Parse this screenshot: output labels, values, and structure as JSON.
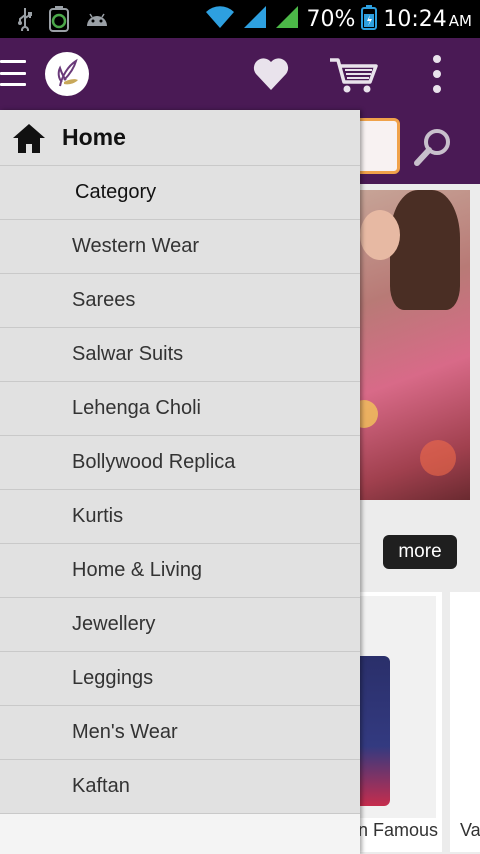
{
  "status_bar": {
    "battery_percent": "70%",
    "time": "10:24",
    "ampm": "AM",
    "icons": [
      "usb-icon",
      "battery-saver-icon",
      "android-icon",
      "wifi-icon",
      "signal-icon",
      "signal-icon",
      "battery-icon"
    ]
  },
  "app_bar": {
    "bg_color": "#4a1a55",
    "icons": [
      "menu-icon",
      "logo",
      "heart-icon",
      "cart-icon",
      "more-vert-icon"
    ]
  },
  "background": {
    "more_label": "more",
    "products": [
      {
        "caption": "n Famous"
      },
      {
        "caption": "Va"
      }
    ]
  },
  "drawer": {
    "home_label": "Home",
    "category_label": "Category",
    "items": [
      {
        "label": "Western Wear"
      },
      {
        "label": "Sarees"
      },
      {
        "label": "Salwar Suits"
      },
      {
        "label": "Lehenga Choli"
      },
      {
        "label": "Bollywood Replica"
      },
      {
        "label": "Kurtis"
      },
      {
        "label": "Home & Living"
      },
      {
        "label": "Jewellery"
      },
      {
        "label": "Leggings"
      },
      {
        "label": "Men's Wear"
      },
      {
        "label": "Kaftan"
      }
    ]
  },
  "colors": {
    "brand": "#4a1a55",
    "search_border": "#f0a24a",
    "drawer_item_bg": "#e1e1e1"
  }
}
